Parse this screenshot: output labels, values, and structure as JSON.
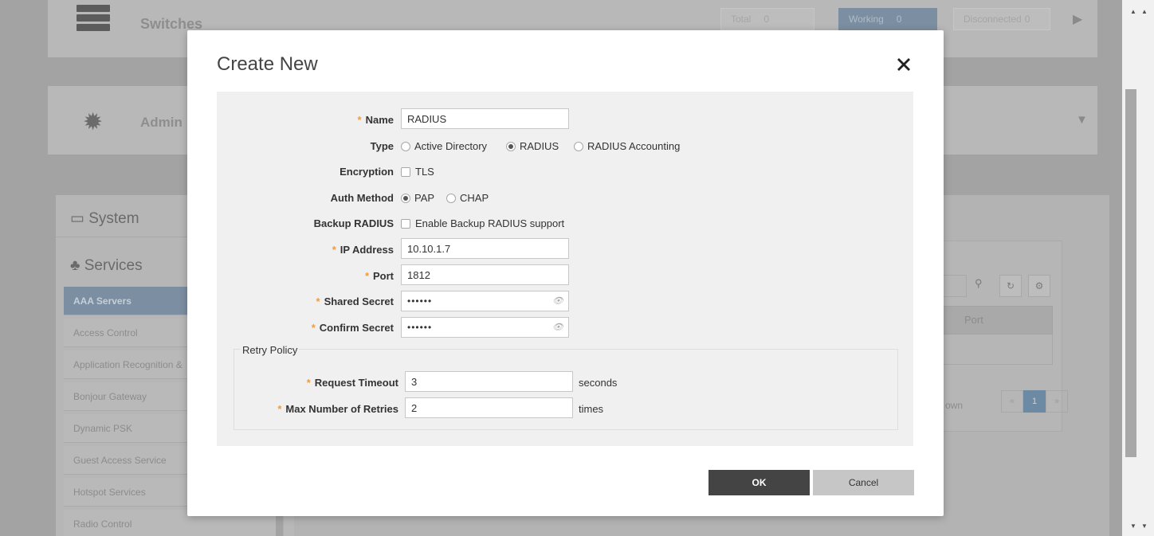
{
  "background": {
    "switches": {
      "title": "Switches",
      "total_label": "Total",
      "total_value": "0",
      "working_label": "Working",
      "working_value": "0",
      "disconnected_label": "Disconnected",
      "disconnected_value": "0"
    },
    "admin": {
      "title": "Admin"
    },
    "sidebar": {
      "system_label": "System",
      "services_label": "Services",
      "items": [
        "AAA Servers",
        "Access Control",
        "Application Recognition &",
        "Bonjour Gateway",
        "Dynamic PSK",
        "Guest Access Service",
        "Hotspot Services",
        "Radio Control"
      ]
    },
    "table": {
      "port_header": "Port",
      "shown_text": "own",
      "page": "1",
      "prev": "«",
      "next": "»"
    }
  },
  "modal": {
    "title": "Create New",
    "fields": {
      "name": {
        "label": "Name",
        "value": "RADIUS"
      },
      "type": {
        "label": "Type",
        "options": [
          "Active Directory",
          "RADIUS",
          "RADIUS Accounting"
        ],
        "selected": "RADIUS"
      },
      "encryption": {
        "label": "Encryption",
        "option": "TLS",
        "checked": false
      },
      "auth_method": {
        "label": "Auth Method",
        "options": [
          "PAP",
          "CHAP"
        ],
        "selected": "PAP"
      },
      "backup_radius": {
        "label": "Backup RADIUS",
        "option": "Enable Backup RADIUS support",
        "checked": false
      },
      "ip_address": {
        "label": "IP Address",
        "value": "10.10.1.7"
      },
      "port": {
        "label": "Port",
        "value": "1812"
      },
      "shared_secret": {
        "label": "Shared Secret",
        "value": "••••••"
      },
      "confirm_secret": {
        "label": "Confirm Secret",
        "value": "••••••"
      }
    },
    "retry_policy": {
      "legend": "Retry Policy",
      "request_timeout": {
        "label": "Request Timeout",
        "value": "3",
        "unit": "seconds"
      },
      "max_retries": {
        "label": "Max Number of Retries",
        "value": "2",
        "unit": "times"
      }
    },
    "buttons": {
      "ok": "OK",
      "cancel": "Cancel"
    }
  },
  "colors": {
    "accent_required": "#f29b3b",
    "ok_button": "#444444",
    "cancel_button": "#c6c6c6",
    "selected_row": "#7c8ea2"
  },
  "icons": [
    "switches-icon",
    "gear-icon",
    "laptop-icon",
    "services-icon",
    "search-icon",
    "refresh-icon",
    "settings-icon",
    "close-icon",
    "eye-slash-icon",
    "chevron-right-icon",
    "chevron-down-icon"
  ]
}
